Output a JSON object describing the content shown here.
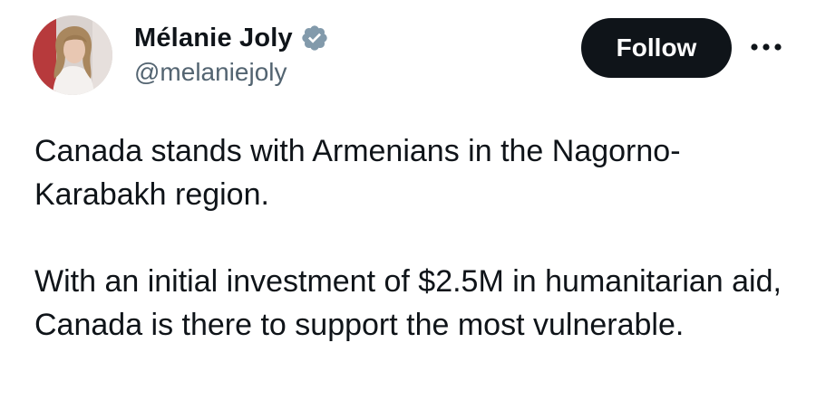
{
  "author": {
    "display_name": "Mélanie Joly",
    "handle": "@melaniejoly",
    "verified_icon": "verified-badge-icon",
    "avatar": "profile-photo"
  },
  "actions": {
    "follow_label": "Follow",
    "more_icon": "more-options-icon"
  },
  "tweet": {
    "paragraphs": [
      "Canada stands with Armenians in the Nagorno-Karabakh region.",
      "With an initial investment of $2.5M in humanitarian aid, Canada is there to support the most vulnerable."
    ]
  },
  "colors": {
    "text": "#0f1419",
    "secondary_text": "#536471",
    "follow_bg": "#0f1419",
    "follow_text": "#ffffff",
    "badge": "#829aab"
  }
}
